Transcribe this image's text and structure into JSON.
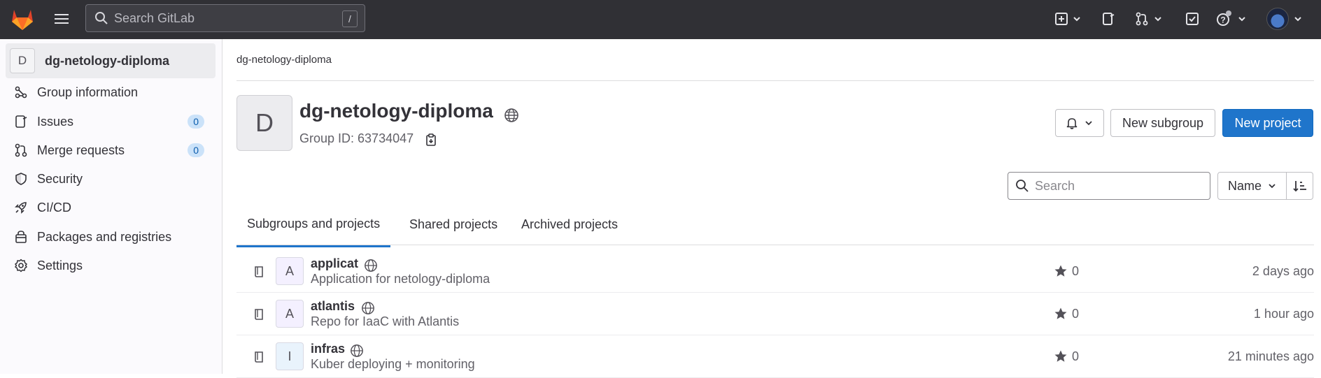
{
  "topbar": {
    "search_placeholder": "Search GitLab",
    "search_shortcut": "/",
    "icons": [
      "tanuki-logo-icon",
      "hamburger-menu-icon",
      "search-icon",
      "create-new-icon",
      "issues-icon",
      "merge-requests-icon",
      "todos-icon",
      "help-icon",
      "user-avatar"
    ]
  },
  "sidebar": {
    "group_initial": "D",
    "group_name": "dg-netology-diploma",
    "items": [
      {
        "label": "Group information",
        "icon": "group-info-icon"
      },
      {
        "label": "Issues",
        "icon": "issues-icon",
        "badge": "0"
      },
      {
        "label": "Merge requests",
        "icon": "merge-request-icon",
        "badge": "0"
      },
      {
        "label": "Security",
        "icon": "shield-icon"
      },
      {
        "label": "CI/CD",
        "icon": "rocket-icon"
      },
      {
        "label": "Packages and registries",
        "icon": "package-icon"
      },
      {
        "label": "Settings",
        "icon": "gear-icon"
      }
    ]
  },
  "main": {
    "breadcrumb": "dg-netology-diploma",
    "group_initial": "D",
    "title": "dg-netology-diploma",
    "group_id": "Group ID: 63734047",
    "buttons": {
      "new_subgroup": "New subgroup",
      "new_project": "New project"
    },
    "tabs": [
      "Subgroups and projects",
      "Shared projects",
      "Archived projects"
    ],
    "filter_placeholder": "Search",
    "sort_label": "Name",
    "projects": [
      {
        "initial": "A",
        "name": "applicat",
        "description": "Application for netology-diploma",
        "stars": "0",
        "updated": "2 days ago",
        "avatar_color": "#f4f0ff"
      },
      {
        "initial": "A",
        "name": "atlantis",
        "description": "Repo for IaaC with Atlantis",
        "stars": "0",
        "updated": "1 hour ago",
        "avatar_color": "#f4f0ff"
      },
      {
        "initial": "I",
        "name": "infras",
        "description": "Kuber deploying + monitoring",
        "stars": "0",
        "updated": "21 minutes ago",
        "avatar_color": "#e9f3fc"
      }
    ]
  },
  "colors": {
    "topbar": "#303035",
    "primary": "#1f75cb",
    "badge_bg": "#cbe2f9"
  }
}
